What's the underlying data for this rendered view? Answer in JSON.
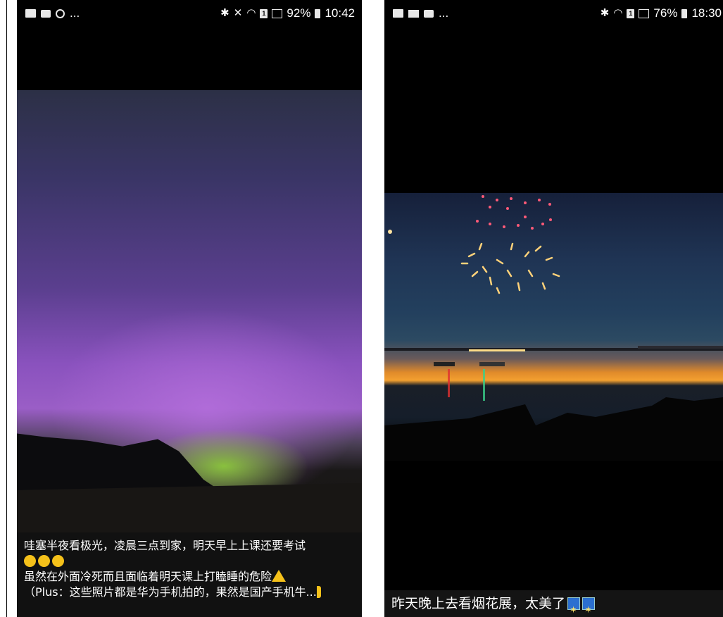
{
  "left_phone": {
    "status_bar": {
      "left_icons": [
        "image-icon",
        "message-icon",
        "whatsapp-icon"
      ],
      "more": "...",
      "right_icons": [
        "bluetooth-icon",
        "mute-icon",
        "wifi-icon",
        "sim-icon",
        "signal-icon"
      ],
      "battery_percent": "92%",
      "time": "10:42"
    },
    "caption": {
      "line1": "哇塞半夜看极光，凌晨三点到家，明天早上上课还要考试",
      "line2_emojis": [
        "thinking-emoji",
        "thinking-emoji",
        "thinking-emoji"
      ],
      "line3": "虽然在外面冷死而且面临着明天课上打瞌睡的危险",
      "line4": "（Plus：这些照片都是华为手机拍的，果然是国产手机牛..."
    }
  },
  "right_phone": {
    "status_bar": {
      "left_icons": [
        "image-icon",
        "mail-icon",
        "message-icon"
      ],
      "more": "...",
      "right_icons": [
        "bluetooth-icon",
        "wifi-icon",
        "sim-icon",
        "signal-icon"
      ],
      "battery_percent": "76%",
      "time": "18:30"
    },
    "caption": {
      "text": "昨天晚上去看烟花展，太美了",
      "emojis": [
        "fireworks-emoji",
        "fireworks-emoji"
      ]
    }
  },
  "colors": {
    "aurora_purple": "#8a52be",
    "aurora_green": "#8cc83c",
    "sunset_orange": "#f3a030",
    "emoji_yellow": "#f5c11a"
  }
}
